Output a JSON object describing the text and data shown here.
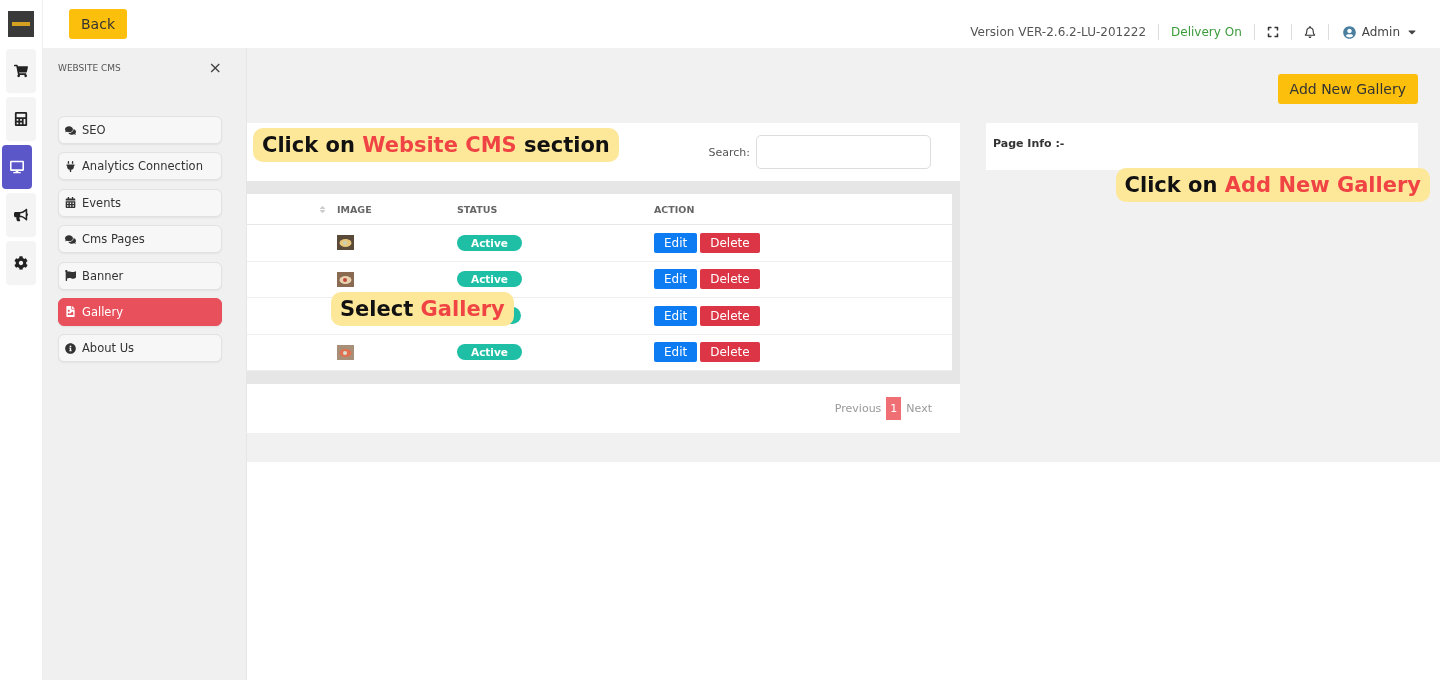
{
  "topbar": {
    "back_button": "Back",
    "version": "Version VER-2.6.2-LU-201222",
    "delivery": "Delivery On",
    "user": "Admin"
  },
  "rail": {
    "items": [
      {
        "selected": false
      },
      {
        "selected": false
      },
      {
        "selected": true
      },
      {
        "selected": false
      },
      {
        "selected": false
      }
    ]
  },
  "drawer": {
    "title": "WEBSITE CMS",
    "close": "×",
    "items": [
      {
        "label": "SEO",
        "selected": false
      },
      {
        "label": "Analytics Connection",
        "selected": false
      },
      {
        "label": "Events",
        "selected": false
      },
      {
        "label": "Cms Pages",
        "selected": false
      },
      {
        "label": "Banner",
        "selected": false
      },
      {
        "label": "Gallery",
        "selected": true
      },
      {
        "label": "About Us",
        "selected": false
      }
    ]
  },
  "add_button": "Add New Gallery",
  "table": {
    "search_label": "Search:",
    "columns": [
      "IMAGE",
      "STATUS",
      "ACTION"
    ],
    "rows": [
      {
        "status": "Active",
        "edit": "Edit",
        "delete": "Delete"
      },
      {
        "status": "Active",
        "edit": "Edit",
        "delete": "Delete"
      },
      {
        "edit": "Edit",
        "delete": "Delete"
      },
      {
        "status": "Active",
        "edit": "Edit",
        "delete": "Delete"
      }
    ],
    "pagination": {
      "previous": "Previous",
      "pages": [
        {
          "label": "1",
          "selected": true
        }
      ],
      "next": "Next"
    }
  },
  "page_info": {
    "title": "Page Info :-"
  },
  "callouts": [
    {
      "before": "Click on ",
      "highlight": "Website CMS",
      "after": " section"
    },
    {
      "before": "Select ",
      "highlight": "Gallery"
    },
    {
      "before": "Click on ",
      "highlight": "Add New Gallery"
    }
  ]
}
